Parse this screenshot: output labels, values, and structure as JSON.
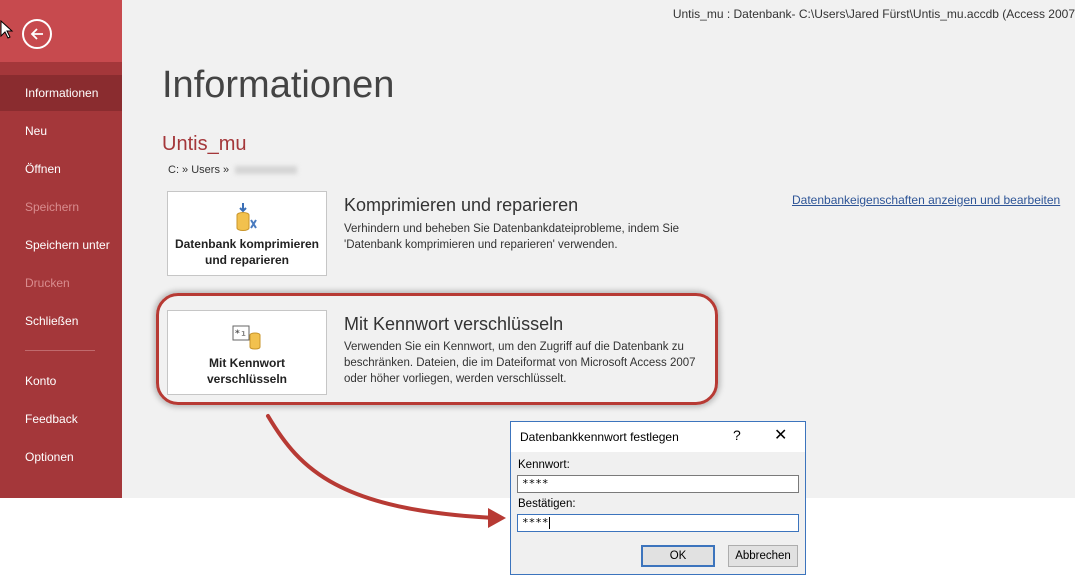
{
  "window": {
    "title": "Untis_mu : Datenbank- C:\\Users\\Jared Fürst\\Untis_mu.accdb (Access 2007"
  },
  "sidebar": {
    "items": [
      {
        "label": "Informationen",
        "state": "active"
      },
      {
        "label": "Neu",
        "state": "normal"
      },
      {
        "label": "Öffnen",
        "state": "normal"
      },
      {
        "label": "Speichern",
        "state": "disabled"
      },
      {
        "label": "Speichern unter",
        "state": "normal"
      },
      {
        "label": "Drucken",
        "state": "disabled"
      },
      {
        "label": "Schließen",
        "state": "normal"
      },
      {
        "label": "Konto",
        "state": "normal"
      },
      {
        "label": "Feedback",
        "state": "normal"
      },
      {
        "label": "Optionen",
        "state": "normal"
      }
    ]
  },
  "main": {
    "heading": "Informationen",
    "db_name": "Untis_mu",
    "path_prefix": "C: » Users »",
    "properties_link": "Datenbankeigenschaften anzeigen und bearbeiten",
    "sections": [
      {
        "tile_line1": "Datenbank komprimieren",
        "tile_line2": "und reparieren",
        "title": "Komprimieren und reparieren",
        "desc_line1": "Verhindern und beheben Sie Datenbankdateiprobleme, indem Sie",
        "desc_line2": "'Datenbank komprimieren und reparieren' verwenden."
      },
      {
        "tile_line1": "Mit Kennwort",
        "tile_line2": "verschlüsseln",
        "title": "Mit Kennwort verschlüsseln",
        "desc_line1": "Verwenden Sie ein Kennwort, um den Zugriff auf die Datenbank zu",
        "desc_line2": "beschränken. Dateien, die im Dateiformat von Microsoft Access 2007",
        "desc_line3": "oder höher vorliegen, werden verschlüsselt."
      }
    ]
  },
  "dialog": {
    "title": "Datenbankkennwort festlegen",
    "help": "?",
    "close": "✕",
    "password_label": "Kennwort:",
    "password_value": "****",
    "confirm_label": "Bestätigen:",
    "confirm_value": "****",
    "ok_label": "OK",
    "cancel_label": "Abbrechen"
  },
  "colors": {
    "sidebar": "#a4373a",
    "accent": "#a4373a",
    "highlight": "#b73a34",
    "link": "#2e5597"
  }
}
